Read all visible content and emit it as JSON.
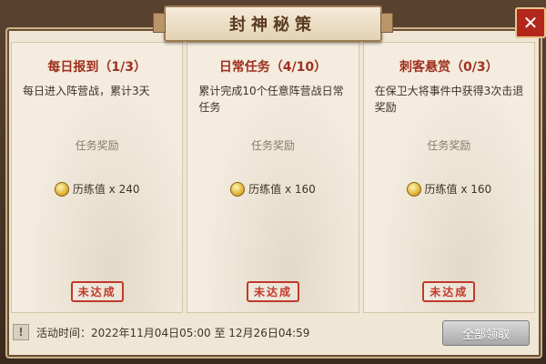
{
  "dialog": {
    "title": "封神秘策",
    "close_icon": "close-icon"
  },
  "tasks": [
    {
      "title": "每日报到（1/3）",
      "description": "每日进入阵营战，累计3天",
      "reward_label": "任务奖励",
      "reward_icon": "coin-icon",
      "reward_text": "历练值 x 240",
      "status": "未达成"
    },
    {
      "title": "日常任务（4/10）",
      "description": "累计完成10个任意阵营战日常任务",
      "reward_label": "任务奖励",
      "reward_icon": "coin-icon",
      "reward_text": "历练值 x 160",
      "status": "未达成"
    },
    {
      "title": "刺客悬赏（0/3）",
      "description": "在保卫大将事件中获得3次击退奖励",
      "reward_label": "任务奖励",
      "reward_icon": "coin-icon",
      "reward_text": "历练值 x 160",
      "status": "未达成"
    }
  ],
  "footer": {
    "info_icon": "!",
    "event_time": "活动时间：2022年11月04日05:00 至 12月26日04:59",
    "claim_all_label": "全部领取"
  },
  "colors": {
    "title_red": "#a0301e",
    "stamp_red": "#c0392b",
    "close_red": "#b3261c"
  }
}
